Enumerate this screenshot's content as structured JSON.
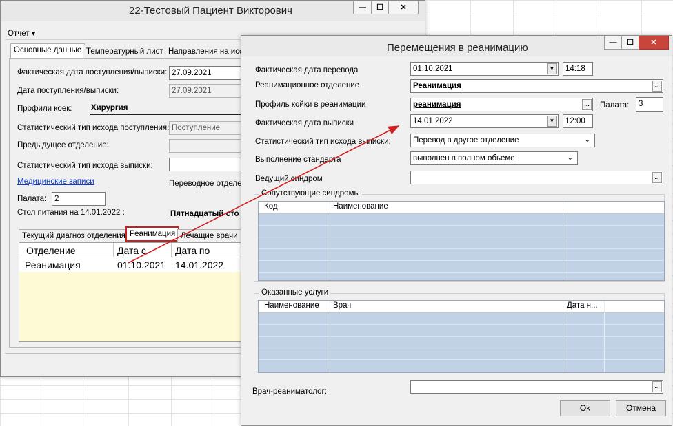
{
  "back_window": {
    "title": "22-Тестовый Пациент Викторович",
    "menu": "Отчет ▾",
    "tabs": [
      "Основные данные",
      "Температурный лист",
      "Направления на иссл"
    ],
    "fields": {
      "actual_date_label": "Фактическая дата поступления/выписки:",
      "actual_date_value": "27.09.2021",
      "date_label": "Дата поступления/выписки:",
      "date_value": "27.09.2021",
      "profile_label": "Профили коек:",
      "profile_value": "Хирургия",
      "stat_in_label": "Статистический тип исхода поступления:",
      "stat_in_value": "Поступление",
      "prev_dept_label": "Предыдущее отделение:",
      "stat_out_label": "Статистический тип исхода выписки:",
      "med_records_link": "Медицинские записи",
      "transfer_dept_label": "Переводное отделен",
      "ward_label": "Палата:",
      "ward_value": "2",
      "meal_label": "Стол питания на 14.01.2022 :",
      "meal_value": "Пятнадцатый сто"
    },
    "subtabs": [
      "Текущий диагноз отделения",
      "Реанимация",
      "Лечащие врачи"
    ],
    "table": {
      "headers": [
        "Отделение",
        "Дата с",
        "Дата по"
      ],
      "rows": [
        [
          "Реанимация",
          "01.10.2021",
          "14.01.2022"
        ]
      ]
    }
  },
  "dialog": {
    "title": "Перемещения в реанимацию",
    "fields": {
      "transfer_date_label": "Фактическая дата перевода",
      "transfer_date_value": "01.10.2021",
      "transfer_time_value": "14:18",
      "icu_dept_label": "Реанимационное отделение",
      "icu_dept_value": "Реанимация",
      "bed_profile_label": "Профиль койки в реанимации",
      "bed_profile_value": "реанимация",
      "ward_label": "Палата:",
      "ward_value": "3",
      "discharge_date_label": "Фактическая дата выписки",
      "discharge_date_value": "14.01.2022",
      "discharge_time_value": "12:00",
      "stat_out_label": "Статистический тип исхода выписки:",
      "stat_out_value": "Перевод в другое отделение",
      "standard_label": "Выполнение стандарта",
      "standard_value": "выполнен в полном обьеме",
      "lead_syndrome_label": "Ведущий синдром"
    },
    "syndromes": {
      "group_label": "Сопутствующие синдромы",
      "headers": [
        "Код",
        "Наименование"
      ]
    },
    "services": {
      "group_label": "Оказанные услуги",
      "headers": [
        "Наименование",
        "Врач",
        "Дата н..."
      ]
    },
    "doctor_label": "Врач-реаниматолог:",
    "ok_label": "Ok",
    "cancel_label": "Отмена"
  },
  "colors": {
    "grid_fill": "#c2d2e6",
    "arrow": "#d42020",
    "highlight_box": "#c81e1e",
    "close_button": "#c9443a"
  },
  "icons": [
    "minimize-icon",
    "maximize-icon",
    "close-icon",
    "dropdown-arrow-icon",
    "ellipsis-icon",
    "annotation-arrow"
  ]
}
